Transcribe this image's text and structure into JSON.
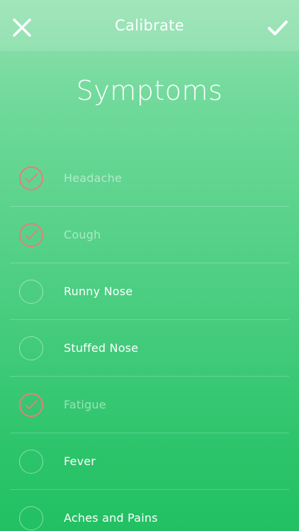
{
  "header": {
    "title": "Calibrate",
    "close_icon": "close-icon",
    "confirm_icon": "checkmark-icon"
  },
  "page": {
    "heading": "Symptoms"
  },
  "colors": {
    "accent_check": "#e57f7c",
    "gradient_top": "#93e1b0",
    "gradient_bottom": "#22c063"
  },
  "symptoms": [
    {
      "label": "Headache",
      "checked": true
    },
    {
      "label": "Cough",
      "checked": true
    },
    {
      "label": "Runny Nose",
      "checked": false
    },
    {
      "label": "Stuffed Nose",
      "checked": false
    },
    {
      "label": "Fatigue",
      "checked": true
    },
    {
      "label": "Fever",
      "checked": false
    },
    {
      "label": "Aches and Pains",
      "checked": false
    }
  ]
}
